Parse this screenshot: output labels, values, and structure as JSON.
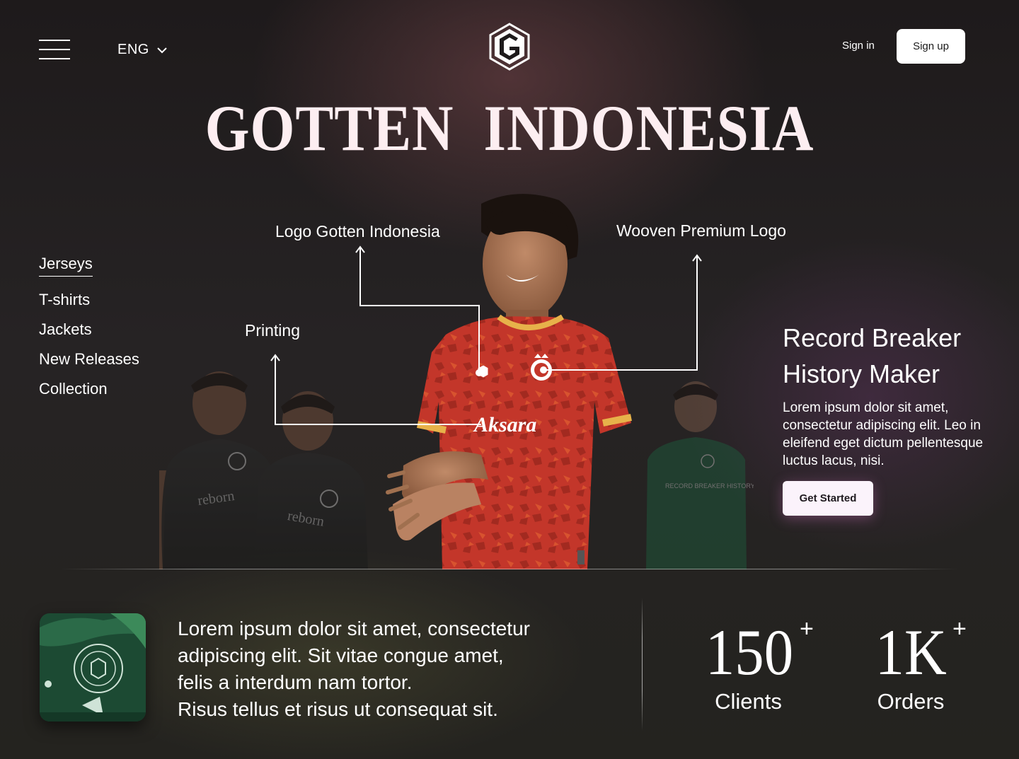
{
  "header": {
    "language": "ENG",
    "sign_in": "Sign in",
    "sign_up": "Sign up",
    "logo_icon": "gotten-g-hexagon-icon"
  },
  "hero": {
    "title": "GOTTEN  INDONESIA"
  },
  "sidenav": {
    "items": [
      {
        "label": "Jerseys",
        "active": true
      },
      {
        "label": "T-shirts"
      },
      {
        "label": "Jackets"
      },
      {
        "label": "New Releases"
      },
      {
        "label": "Collection"
      }
    ]
  },
  "annotations": {
    "logo": "Logo Gotten Indonesia",
    "woven": "Wooven Premium Logo",
    "printing": "Printing"
  },
  "jersey": {
    "sponsor": "Aksara",
    "left_jersey_text": "reborn",
    "right_jersey_text": "RECORD BREAKER HISTORY MAKER"
  },
  "promo": {
    "title_line1": "Record Breaker",
    "title_line2": "History Maker",
    "body": "Lorem ipsum dolor sit amet, consectetur adipiscing elit. Leo in eleifend eget dictum pellentesque luctus lacus, nisi.",
    "cta": "Get Started"
  },
  "bottom": {
    "text_line1": "Lorem ipsum dolor sit amet, consectetur",
    "text_line2": "adipiscing elit. Sit vitae congue amet,",
    "text_line3": "felis a interdum nam tortor.",
    "text_line4": "Risus tellus et risus ut consequat sit.",
    "stats": [
      {
        "value": "150",
        "suffix": "+",
        "label": "Clients"
      },
      {
        "value": "1K",
        "suffix": "+",
        "label": "Orders"
      }
    ]
  },
  "colors": {
    "title": "#fdeef1",
    "jersey_red": "#c3362a",
    "jersey_gold": "#e7b24a",
    "jersey_green": "#1e5a3c",
    "cta_bg": "#fbf3fb"
  }
}
